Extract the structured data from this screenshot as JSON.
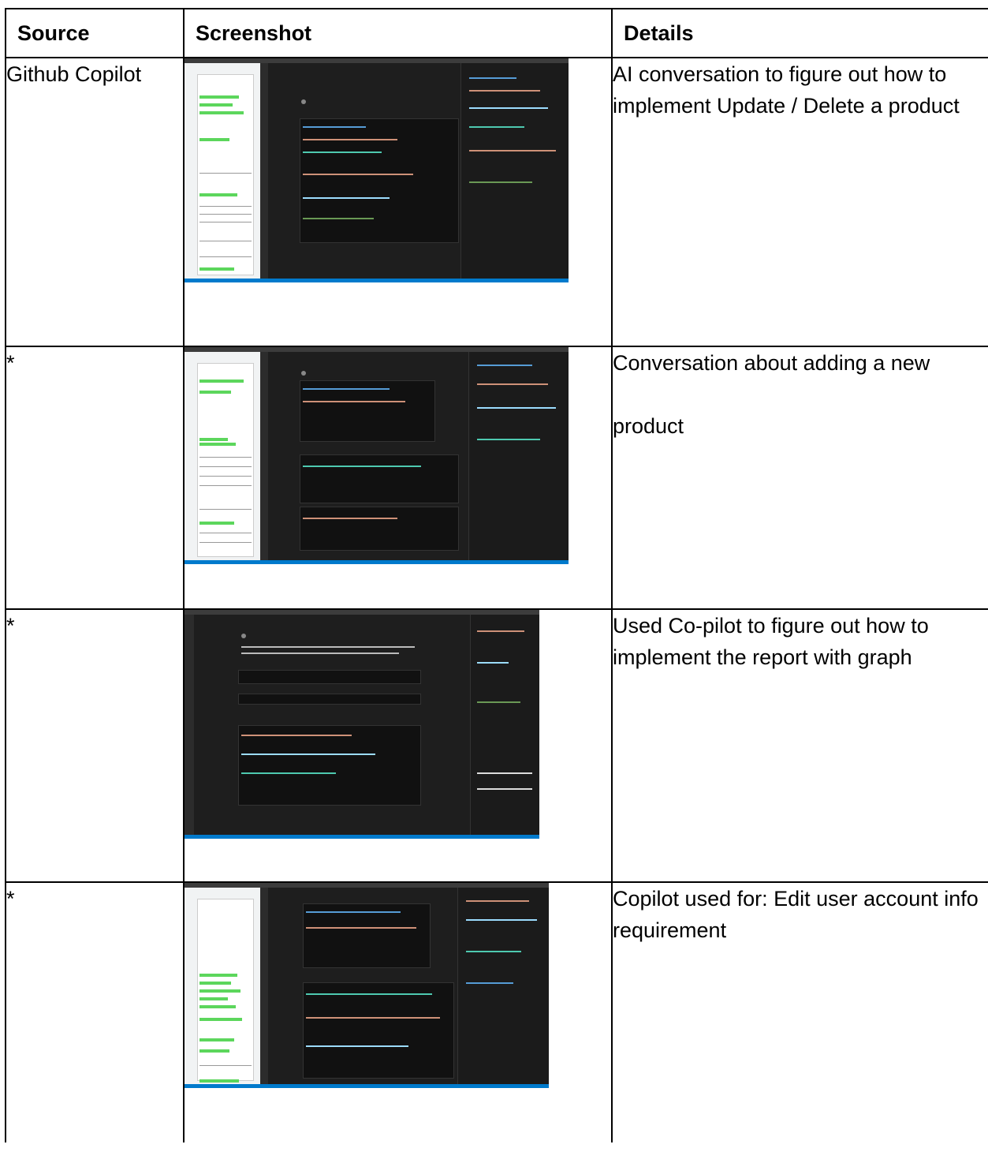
{
  "headers": {
    "source": "Source",
    "screenshot": "Screenshot",
    "details": "Details"
  },
  "rows": [
    {
      "source": "Github Copilot",
      "details": "AI conversation to figure out how to implement Update / Delete a product",
      "thumbnail": "vscode-copilot-chat-with-google-doc"
    },
    {
      "source": "*",
      "details": "Conversation about adding a new",
      "details_line2": "product",
      "thumbnail": "vscode-copilot-chat-with-google-doc"
    },
    {
      "source": "*",
      "details": "Used Co-pilot to figure out how to implement the report with graph",
      "thumbnail": "vscode-copilot-chat"
    },
    {
      "source": "*",
      "details": "Copilot used for: Edit user account info requirement",
      "thumbnail": "vscode-copilot-chat-with-google-doc"
    }
  ],
  "colors": {
    "border": "#000000",
    "ide_bg": "#1e1e1e",
    "highlight": "#5cd65c",
    "status_bar": "#007acc"
  }
}
